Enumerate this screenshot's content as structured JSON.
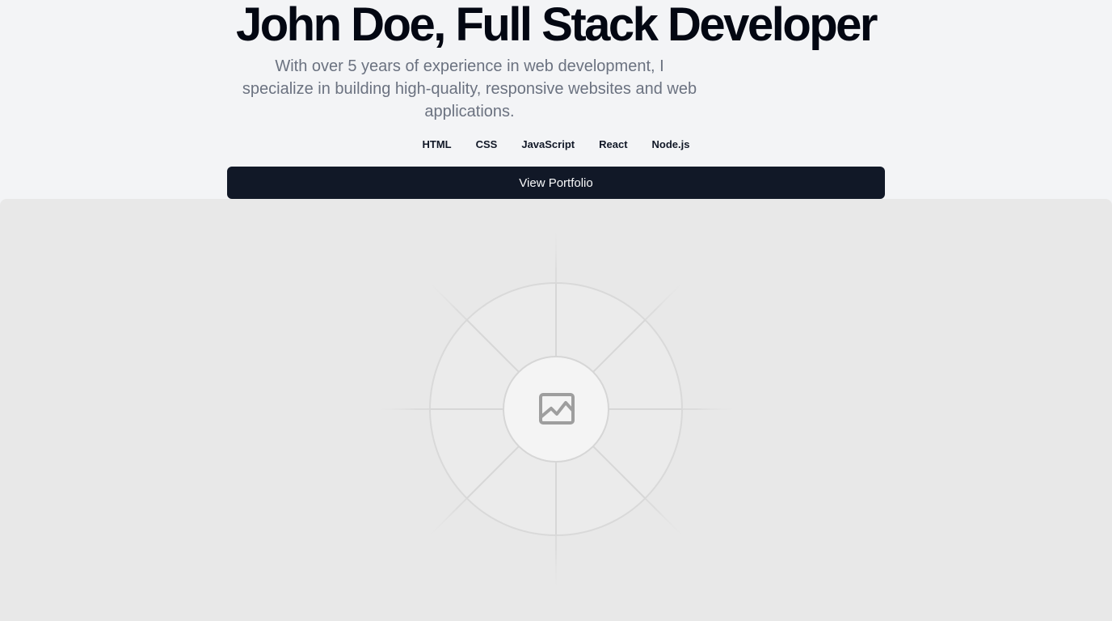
{
  "hero": {
    "title": "John Doe, Full Stack Developer",
    "subtitle": "With over 5 years of experience in web development, I specialize in building high-quality, responsive websites and web applications.",
    "skills": [
      "HTML",
      "CSS",
      "JavaScript",
      "React",
      "Node.js"
    ],
    "cta_label": "View Portfolio"
  },
  "media": {
    "icon": "image-placeholder-icon"
  },
  "colors": {
    "page_background": "#f3f4f6",
    "title": "#030712",
    "subtitle": "#6b7280",
    "button_background": "#111827",
    "button_text": "#f9fafb",
    "placeholder_background": "#e8e8e8"
  }
}
